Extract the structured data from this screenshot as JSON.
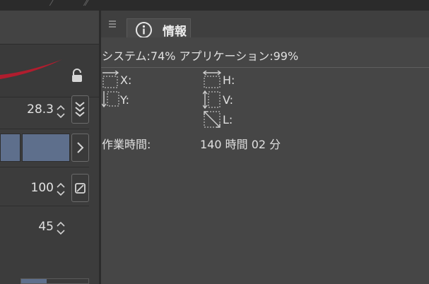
{
  "left_panel": {
    "brush_size": {
      "value": "28.3"
    },
    "opacity": {
      "value": "100"
    },
    "angle": {
      "value": "45"
    }
  },
  "info_panel": {
    "tab_label": "情報",
    "system_usage": "システム:74% アプリケーション:99%",
    "metrics": {
      "x_label": "X:",
      "y_label": "Y:",
      "h_label": "H:",
      "v_label": "V:",
      "l_label": "L:"
    },
    "work_time_label": "作業時間:",
    "work_time_value": "140 時間 02 分"
  },
  "colors": {
    "panel_bg": "#464646",
    "stroke_accent": "#b01d2e",
    "swatch": "#5e6f8c"
  },
  "icons": [
    "lock-open-icon",
    "spinner-arrows-icon",
    "double-chevron-down-icon",
    "chevron-right-icon",
    "no-entry-square-icon",
    "menu-icon",
    "info-icon"
  ]
}
